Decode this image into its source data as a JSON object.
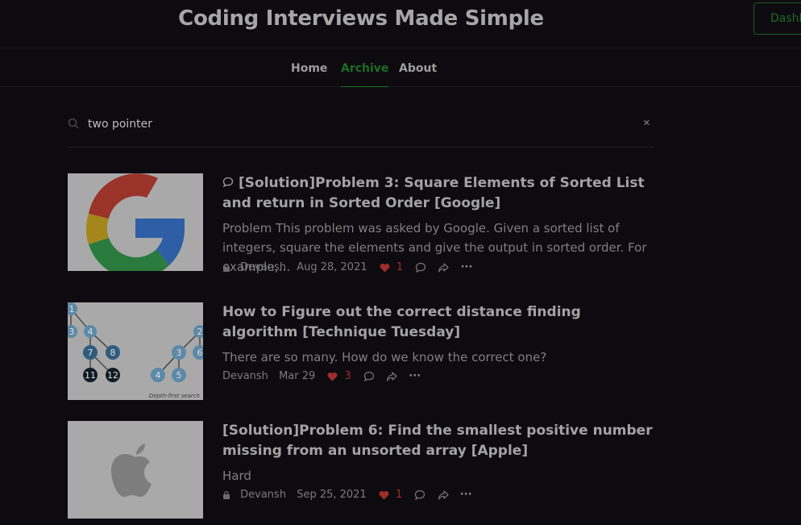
{
  "header": {
    "site_title": "Coding Interviews Made Simple",
    "dashboard_label": "Dashboard"
  },
  "nav": {
    "items": [
      {
        "label": "Home"
      },
      {
        "label": "Archive",
        "active": true
      },
      {
        "label": "About"
      }
    ]
  },
  "search": {
    "value": "two pointer",
    "placeholder": "Search"
  },
  "colors": {
    "accent": "#1e6d25",
    "background": "#0d0b10",
    "like": "#a02c2c"
  },
  "posts": [
    {
      "title": "[Solution]Problem 3: Square Elements of Sorted List and return in Sorted Order [Google]",
      "subtitle": "Problem This problem was asked by Google. Given a sorted list of integers, square the elements and give the output in sorted order. For example,…",
      "author": "Devansh",
      "date": "Aug 28, 2021",
      "likes": "1",
      "locked": true,
      "has_comment_icon": true,
      "thumbnail": "google-logo"
    },
    {
      "title": "How to Figure out the correct distance finding algorithm [Technique Tuesday]",
      "subtitle": "There are so many. How do we know the correct one?",
      "author": "Devansh",
      "date": "Mar 29",
      "likes": "3",
      "locked": false,
      "has_comment_icon": false,
      "thumbnail": "depth-first-search-tree",
      "thumbnail_caption": "Depth-first search",
      "tree_nodes": [
        "1",
        "3",
        "4",
        "7",
        "8",
        "11",
        "12",
        "2",
        "3",
        "4",
        "5",
        "6"
      ]
    },
    {
      "title": "[Solution]Problem 6: Find the smallest positive number missing from an unsorted array [Apple]",
      "subtitle": "Hard",
      "author": "Devansh",
      "date": "Sep 25, 2021",
      "likes": "1",
      "locked": true,
      "has_comment_icon": false,
      "thumbnail": "apple-logo"
    }
  ]
}
